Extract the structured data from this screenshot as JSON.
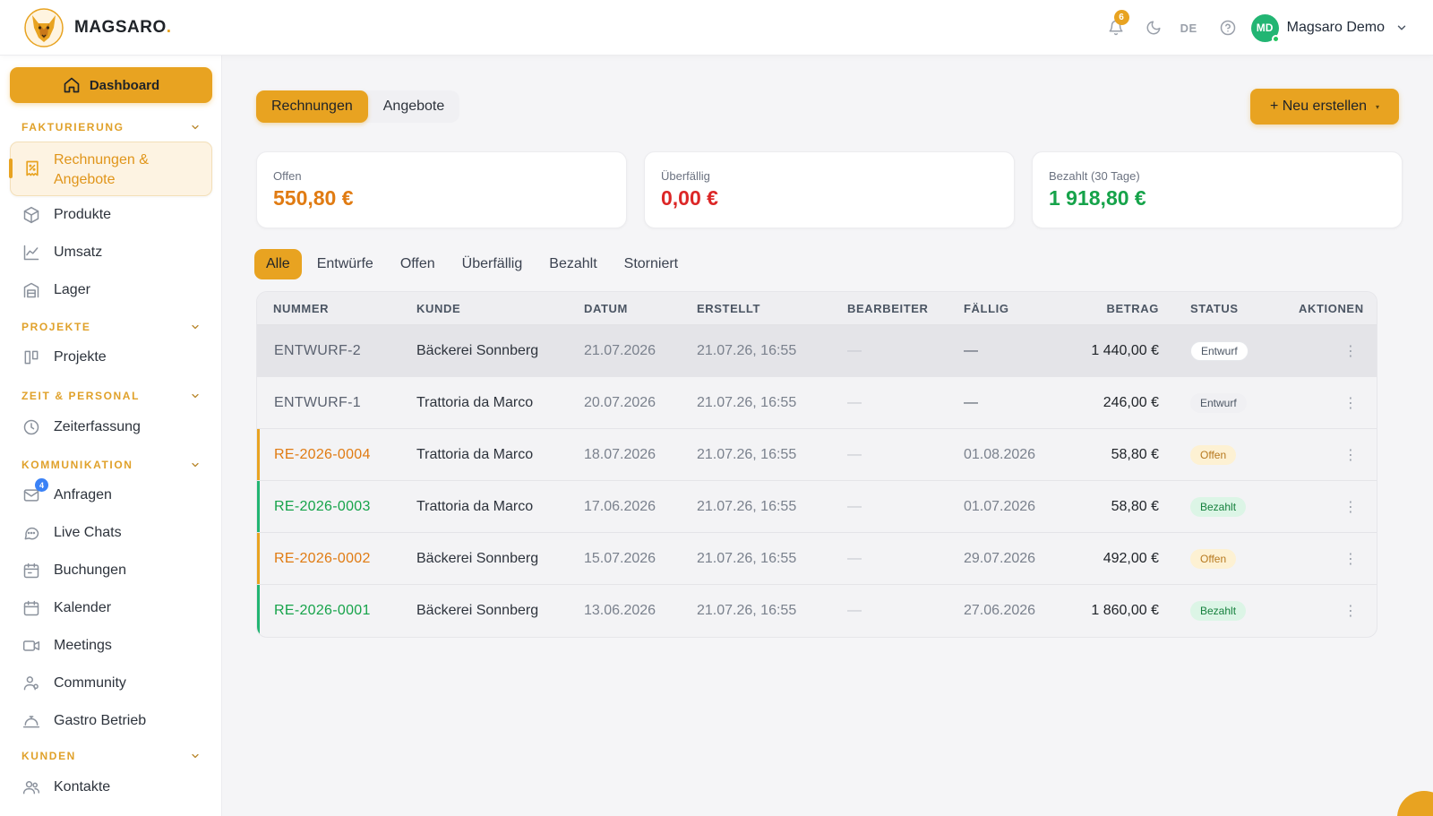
{
  "brand": {
    "name": "MAGSARO",
    "dot": "."
  },
  "topbar": {
    "notification_count": "6",
    "language": "DE",
    "user": {
      "initials": "MD",
      "name": "Magsaro Demo"
    }
  },
  "sidebar": {
    "dashboard_label": "Dashboard",
    "sections": {
      "fakturierung": "FAKTURIERUNG",
      "projekte": "PROJEKTE",
      "zeit": "ZEIT & PERSONAL",
      "kommunikation": "KOMMUNIKATION",
      "kunden": "KUNDEN"
    },
    "items": {
      "rechnungen": "Rechnungen & Angebote",
      "produkte": "Produkte",
      "umsatz": "Umsatz",
      "lager": "Lager",
      "projekte": "Projekte",
      "zeiterfassung": "Zeiterfassung",
      "anfragen": "Anfragen",
      "anfragen_badge": "4",
      "live_chats": "Live Chats",
      "buchungen": "Buchungen",
      "kalender": "Kalender",
      "meetings": "Meetings",
      "community": "Community",
      "gastro": "Gastro Betrieb",
      "kontakte": "Kontakte"
    }
  },
  "main": {
    "tabs": [
      {
        "label": "Rechnungen",
        "active": true
      },
      {
        "label": "Angebote",
        "active": false
      }
    ],
    "new_button": "+ Neu erstellen",
    "new_button_caret": "▾",
    "cards": [
      {
        "label": "Offen",
        "value": "550,80 €",
        "color": "#e07b12"
      },
      {
        "label": "Überfällig",
        "value": "0,00 €",
        "color": "#dc2626"
      },
      {
        "label": "Bezahlt (30 Tage)",
        "value": "1 918,80 €",
        "color": "#16a34a"
      }
    ],
    "filters": [
      "Alle",
      "Entwürfe",
      "Offen",
      "Überfällig",
      "Bezahlt",
      "Storniert"
    ],
    "active_filter": "Alle",
    "table": {
      "columns": {
        "nummer": "NUMMER",
        "kunde": "KUNDE",
        "datum": "DATUM",
        "erstellt": "ERSTELLT",
        "bearbeiter": "BEARBEITER",
        "faellig": "FÄLLIG",
        "betrag": "BETRAG",
        "status": "STATUS",
        "aktionen": "AKTIONEN"
      },
      "rows": [
        {
          "nummer": "ENTWURF-2",
          "kunde": "Bäckerei Sonnberg",
          "datum": "21.07.2026",
          "erstellt": "21.07.26, 16:55",
          "bearbeiter": "—",
          "faellig": "—",
          "betrag": "1 440,00 €",
          "status": "Entwurf"
        },
        {
          "nummer": "ENTWURF-1",
          "kunde": "Trattoria da Marco",
          "datum": "20.07.2026",
          "erstellt": "21.07.26, 16:55",
          "bearbeiter": "—",
          "faellig": "—",
          "betrag": "246,00 €",
          "status": "Entwurf"
        },
        {
          "nummer": "RE-2026-0004",
          "kunde": "Trattoria da Marco",
          "datum": "18.07.2026",
          "erstellt": "21.07.26, 16:55",
          "bearbeiter": "—",
          "faellig": "01.08.2026",
          "betrag": "58,80 €",
          "status": "Offen"
        },
        {
          "nummer": "RE-2026-0003",
          "kunde": "Trattoria da Marco",
          "datum": "17.06.2026",
          "erstellt": "21.07.26, 16:55",
          "bearbeiter": "—",
          "faellig": "01.07.2026",
          "betrag": "58,80 €",
          "status": "Bezahlt"
        },
        {
          "nummer": "RE-2026-0002",
          "kunde": "Bäckerei Sonnberg",
          "datum": "15.07.2026",
          "erstellt": "21.07.26, 16:55",
          "bearbeiter": "—",
          "faellig": "29.07.2026",
          "betrag": "492,00 €",
          "status": "Offen"
        },
        {
          "nummer": "RE-2026-0001",
          "kunde": "Bäckerei Sonnberg",
          "datum": "13.06.2026",
          "erstellt": "21.07.26, 16:55",
          "bearbeiter": "—",
          "faellig": "27.06.2026",
          "betrag": "1 860,00 €",
          "status": "Bezahlt"
        }
      ],
      "actions_glyph": "⋮"
    }
  },
  "colors": {
    "accent": "#e8a321",
    "status_offen": "#e07b12",
    "status_bezahlt": "#16a34a",
    "status_draft": "#5b6270"
  }
}
